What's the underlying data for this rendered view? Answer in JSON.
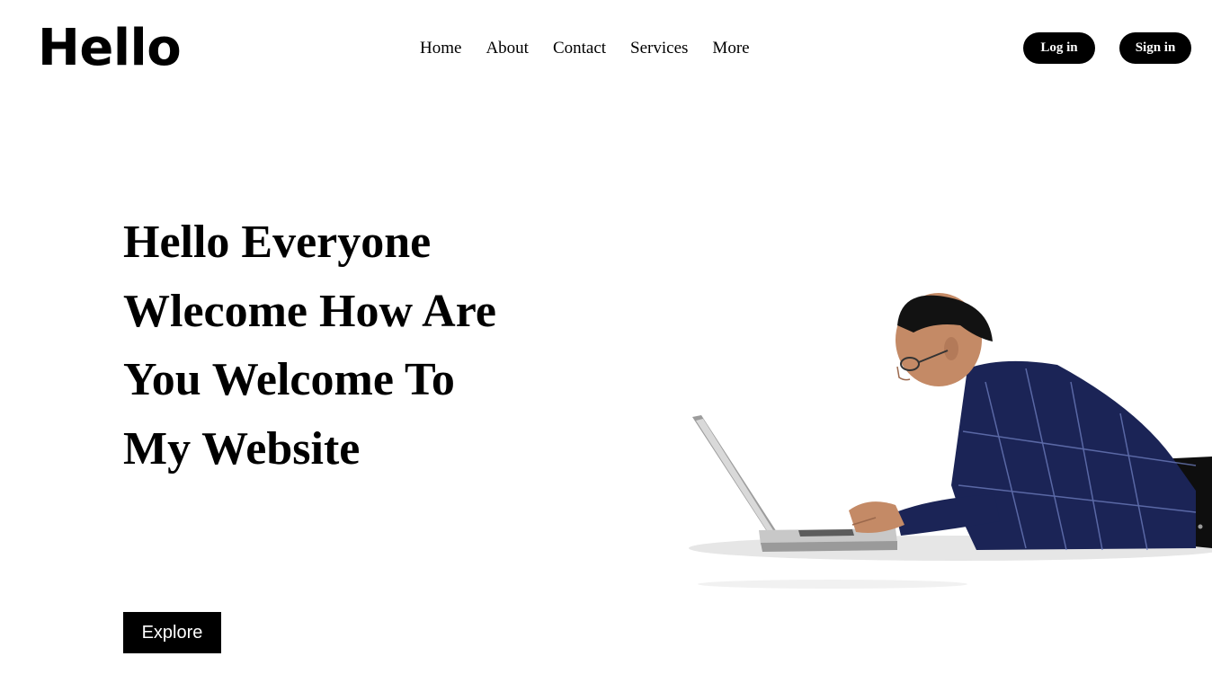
{
  "header": {
    "logo_text": "Hello",
    "nav": [
      {
        "label": "Home"
      },
      {
        "label": "About"
      },
      {
        "label": "Contact"
      },
      {
        "label": "Services"
      },
      {
        "label": "More"
      }
    ],
    "login_label": "Log in",
    "signin_label": "Sign in"
  },
  "hero": {
    "title": "Hello Everyone Wlecome How Are You Welcome To My Website",
    "button_label": "Explore",
    "image_subject": "man-with-laptop"
  },
  "colors": {
    "primary": "#000000",
    "background": "#ffffff",
    "button_text": "#ffffff",
    "shirt": "#1b2456"
  }
}
